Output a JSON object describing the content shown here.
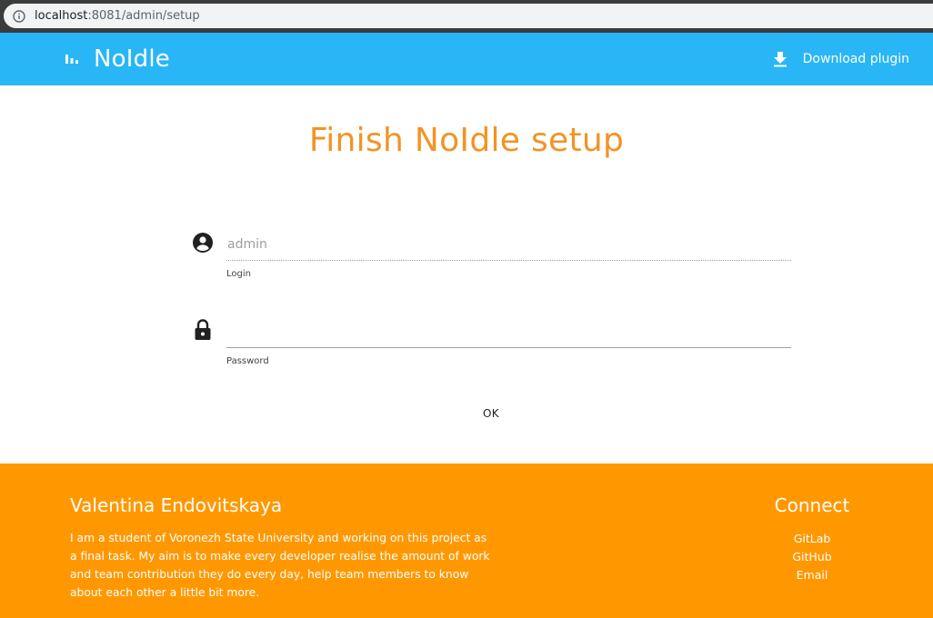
{
  "browser": {
    "url_host": "localhost",
    "url_path": ":8081/admin/setup",
    "info_icon": "info-icon"
  },
  "header": {
    "brand_icon": "bar-chart-icon",
    "brand_title": "NoIdle",
    "download_icon": "download-icon",
    "download_label": "Download plugin",
    "background_color": "#29b6f6"
  },
  "setup": {
    "title": "Finish NoIdle setup",
    "title_color": "#f39325",
    "login": {
      "icon": "account-circle-icon",
      "value": "",
      "placeholder": "admin",
      "label": "Login"
    },
    "password": {
      "icon": "lock-icon",
      "value": "",
      "placeholder": "",
      "label": "Password"
    },
    "submit_label": "OK"
  },
  "footer": {
    "background_color": "#ff9800",
    "author": "Valentina Endovitskaya",
    "about": "I am a student of Voronezh State University and working on this project as a final task. My aim is to make every developer realise the amount of work and team contribution they do every day, help team members to know about each other a little bit more.",
    "connect_title": "Connect",
    "links": [
      {
        "label": "GitLab"
      },
      {
        "label": "GitHub"
      },
      {
        "label": "Email"
      }
    ]
  }
}
